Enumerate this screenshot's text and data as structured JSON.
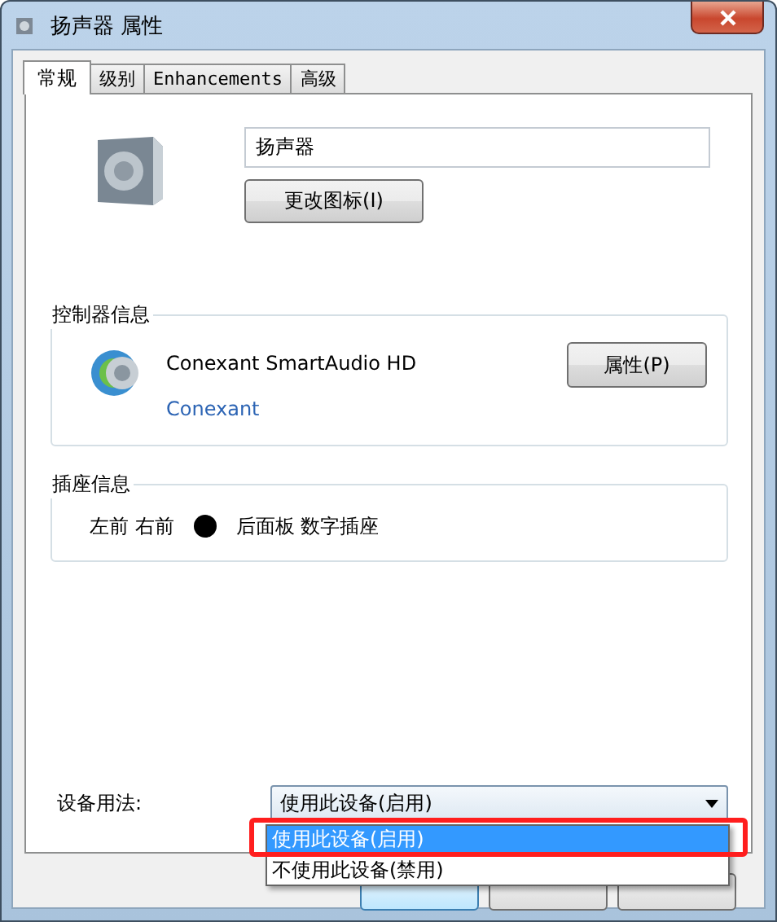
{
  "window": {
    "title": "扬声器 属性"
  },
  "tabs": [
    {
      "label": "常规",
      "selected": true
    },
    {
      "label": "级别",
      "selected": false
    },
    {
      "label": "Enhancements",
      "selected": false
    },
    {
      "label": "高级",
      "selected": false
    }
  ],
  "device": {
    "name": "扬声器",
    "change_icon_button": "更改图标(I)"
  },
  "controller": {
    "legend": "控制器信息",
    "name": "Conexant SmartAudio HD",
    "vendor_link": "Conexant",
    "properties_button": "属性(P)"
  },
  "jack": {
    "legend": "插座信息",
    "channels": "左前 右前",
    "color": "#000000",
    "location": "后面板 数字插座"
  },
  "usage": {
    "label": "设备用法:",
    "value": "使用此设备(启用)",
    "options": [
      {
        "label": "使用此设备(启用)",
        "selected": true
      },
      {
        "label": "不使用此设备(禁用)",
        "selected": false
      }
    ]
  }
}
